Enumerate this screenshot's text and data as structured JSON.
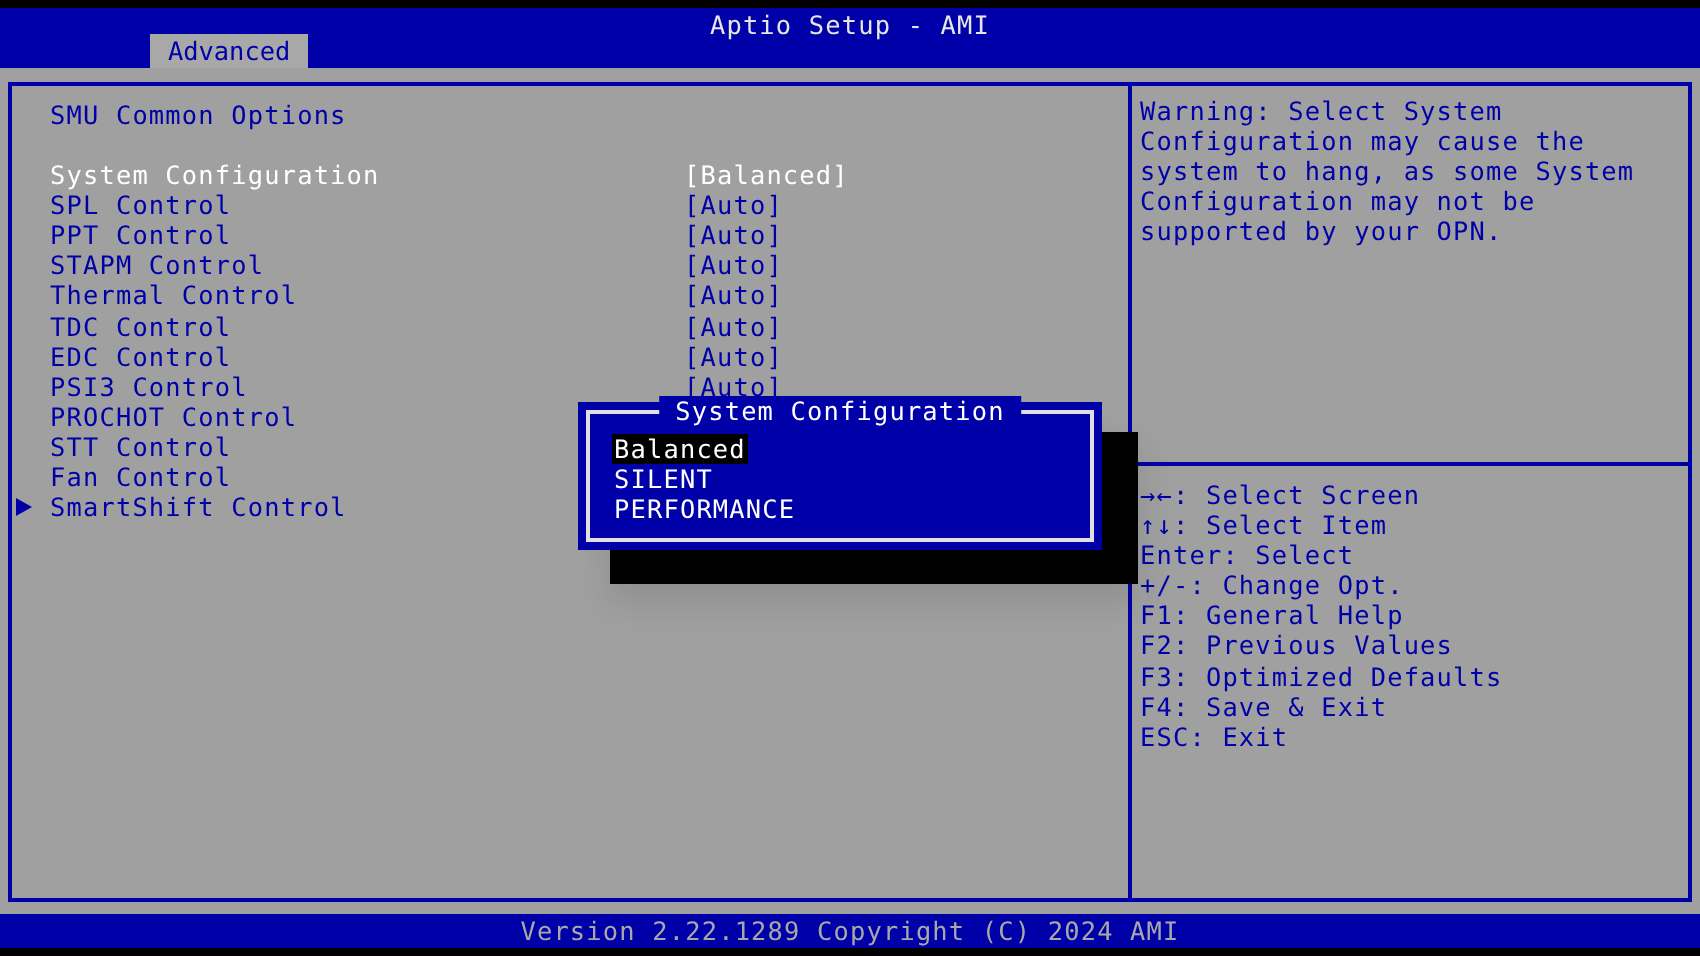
{
  "window": {
    "title": "Aptio Setup - AMI"
  },
  "tabs": [
    {
      "label": "Advanced",
      "selected": true
    }
  ],
  "panel": {
    "title": "SMU Common Options",
    "items": [
      {
        "kind": "setting",
        "label": "System Configuration",
        "value": "[Balanced]",
        "selected": true
      },
      {
        "kind": "setting",
        "label": "SPL Control",
        "value": "[Auto]",
        "selected": false
      },
      {
        "kind": "setting",
        "label": "PPT Control",
        "value": "[Auto]",
        "selected": false
      },
      {
        "kind": "setting",
        "label": "STAPM Control",
        "value": "[Auto]",
        "selected": false
      },
      {
        "kind": "setting",
        "label": "Thermal Control",
        "value": "[Auto]",
        "selected": false
      },
      {
        "kind": "setting",
        "label": "TDC Control",
        "value": "[Auto]",
        "selected": false
      },
      {
        "kind": "setting",
        "label": "EDC Control",
        "value": "[Auto]",
        "selected": false
      },
      {
        "kind": "setting",
        "label": "PSI3 Control",
        "value": "[Auto]",
        "selected": false
      },
      {
        "kind": "setting",
        "label": "PROCHOT Control",
        "selected": false
      },
      {
        "kind": "setting",
        "label": "STT Control",
        "selected": false
      },
      {
        "kind": "setting",
        "label": "Fan Control",
        "selected": false
      },
      {
        "kind": "submenu",
        "label": "SmartShift Control",
        "selected": false
      }
    ]
  },
  "popup": {
    "title": "System Configuration",
    "options": [
      {
        "label": "Balanced",
        "selected": true
      },
      {
        "label": "SILENT",
        "selected": false
      },
      {
        "label": "PERFORMANCE",
        "selected": false
      }
    ]
  },
  "help": {
    "description": "Warning: Select System Configuration may cause the system to hang, as some System Configuration may not be supported by your OPN.",
    "keys": [
      "→←: Select Screen",
      "↑↓: Select Item",
      "Enter: Select",
      "+/-: Change Opt.",
      "F1: General Help",
      "F2: Previous Values",
      "F3: Optimized Defaults",
      "F4: Save & Exit",
      "ESC: Exit"
    ]
  },
  "status_bar": "Version 2.22.1289 Copyright (C) 2024 AMI"
}
